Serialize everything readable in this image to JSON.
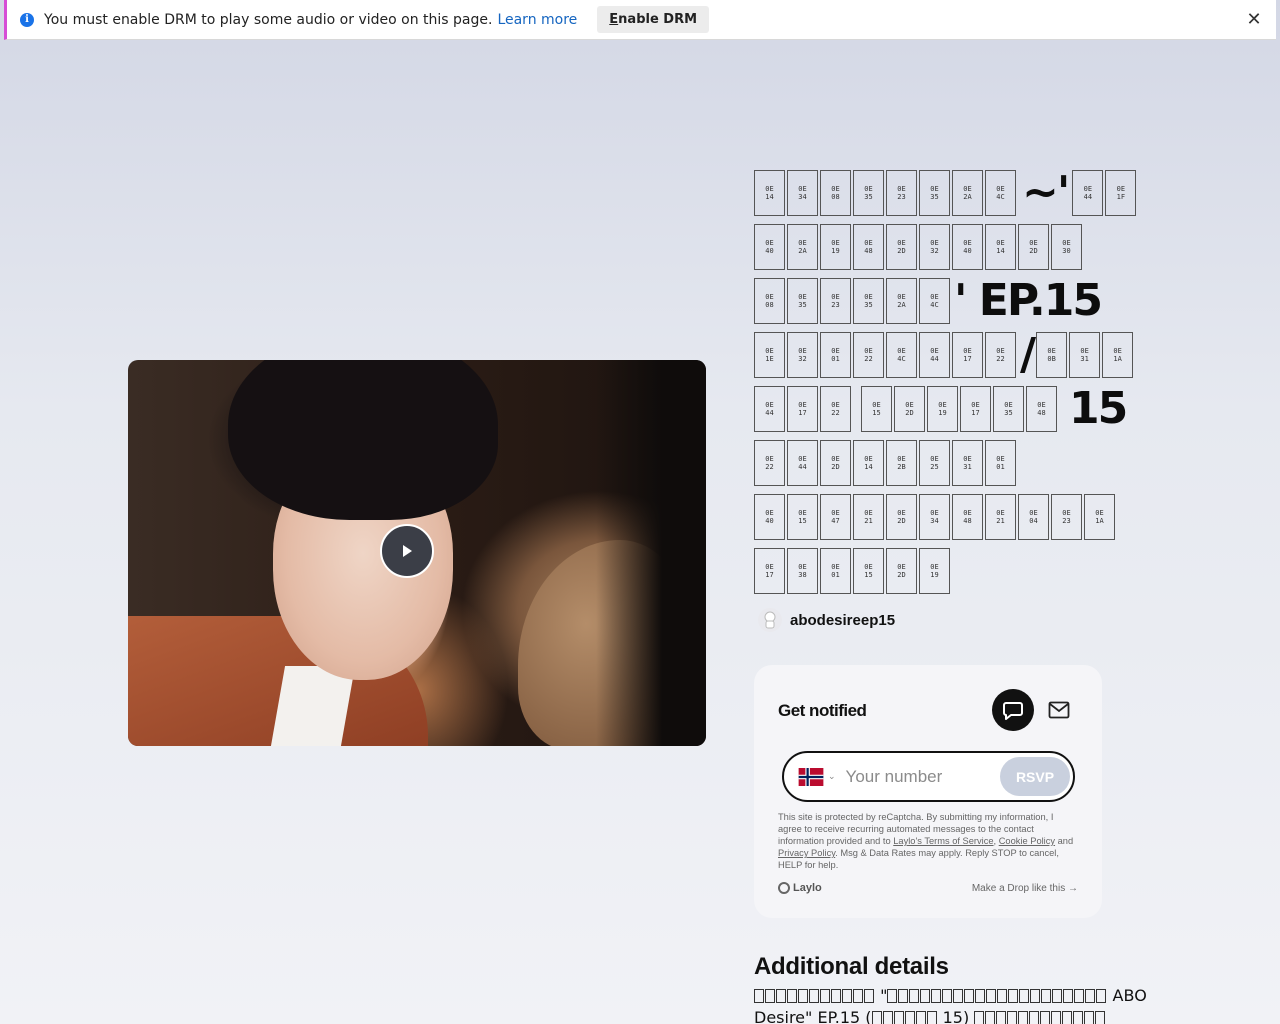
{
  "drm_bar": {
    "message": "You must enable DRM to play some audio or video on this page.",
    "learn_more": "Learn more",
    "enable_label_first": "E",
    "enable_label_rest": "nable DRM",
    "close": "✕"
  },
  "title": {
    "line1": [
      [
        "0E",
        "14"
      ],
      [
        "0E",
        "34"
      ],
      [
        "0E",
        "08"
      ],
      [
        "0E",
        "35"
      ],
      [
        "0E",
        "23"
      ],
      [
        "0E",
        "35"
      ],
      [
        "0E",
        "2A"
      ],
      [
        "0E",
        "4C"
      ]
    ],
    "line1_text": "~'",
    "line1_tail": [
      [
        "0E",
        "44"
      ],
      [
        "0E",
        "1F"
      ]
    ],
    "line2": [
      [
        "0E",
        "40"
      ],
      [
        "0E",
        "2A"
      ],
      [
        "0E",
        "19"
      ],
      [
        "0E",
        "48"
      ],
      [
        "0E",
        "2D"
      ],
      [
        "0E",
        "32"
      ],
      [
        "0E",
        "40"
      ],
      [
        "0E",
        "14"
      ],
      [
        "0E",
        "2D"
      ],
      [
        "0E",
        "30"
      ]
    ],
    "line3": [
      [
        "0E",
        "08"
      ],
      [
        "0E",
        "35"
      ],
      [
        "0E",
        "23"
      ],
      [
        "0E",
        "35"
      ],
      [
        "0E",
        "2A"
      ],
      [
        "0E",
        "4C"
      ]
    ],
    "line3_text": "' EP.15",
    "line4": [
      [
        "0E",
        "1E"
      ],
      [
        "0E",
        "32"
      ],
      [
        "0E",
        "01"
      ],
      [
        "0E",
        "22"
      ],
      [
        "0E",
        "4C"
      ],
      [
        "0E",
        "44"
      ],
      [
        "0E",
        "17"
      ],
      [
        "0E",
        "22"
      ]
    ],
    "line4_text": "/",
    "line4_tail": [
      [
        "0E",
        "0B"
      ],
      [
        "0E",
        "31"
      ],
      [
        "0E",
        "1A"
      ]
    ],
    "line5": [
      [
        "0E",
        "44"
      ],
      [
        "0E",
        "17"
      ],
      [
        "0E",
        "22"
      ]
    ],
    "line5b": [
      [
        "0E",
        "15"
      ],
      [
        "0E",
        "2D"
      ],
      [
        "0E",
        "19"
      ],
      [
        "0E",
        "17"
      ],
      [
        "0E",
        "35"
      ],
      [
        "0E",
        "48"
      ]
    ],
    "line5_text": "15",
    "line6": [
      [
        "0E",
        "22"
      ],
      [
        "0E",
        "44"
      ],
      [
        "0E",
        "2D"
      ],
      [
        "0E",
        "14"
      ],
      [
        "0E",
        "2B"
      ],
      [
        "0E",
        "25"
      ],
      [
        "0E",
        "31"
      ],
      [
        "0E",
        "01"
      ]
    ],
    "line7": [
      [
        "0E",
        "40"
      ],
      [
        "0E",
        "15"
      ],
      [
        "0E",
        "47"
      ],
      [
        "0E",
        "21"
      ],
      [
        "0E",
        "2D"
      ],
      [
        "0E",
        "34"
      ],
      [
        "0E",
        "48"
      ],
      [
        "0E",
        "21"
      ],
      [
        "0E",
        "04"
      ],
      [
        "0E",
        "23"
      ],
      [
        "0E",
        "1A"
      ]
    ],
    "line8": [
      [
        "0E",
        "17"
      ],
      [
        "0E",
        "38"
      ],
      [
        "0E",
        "01"
      ],
      [
        "0E",
        "15"
      ],
      [
        "0E",
        "2D"
      ],
      [
        "0E",
        "19"
      ]
    ]
  },
  "author": {
    "name": "abodesireep15"
  },
  "notify": {
    "title": "Get notified",
    "phone_placeholder": "Your number",
    "rsvp": "RSVP",
    "legal_1": "This site is protected by reCaptcha. By submitting my information, I agree to receive recurring automated messages to the contact information provided and to ",
    "terms": "Laylo's Terms of Service",
    "comma": ", ",
    "cookie": "Cookie Policy",
    "and": " and ",
    "privacy": "Privacy Policy",
    "legal_2": ". Msg & Data Rates may apply. Reply STOP to cancel, HELP for help.",
    "brand": "Laylo",
    "drop_link": "Make a Drop like this  →"
  },
  "details": {
    "heading": "Additional details",
    "line1_text": " \"",
    "line1_end": "ABO",
    "line2_text": "Desire\" EP.15 (",
    "line2_mid": "15)"
  },
  "colors": {
    "accent": "#1565c0",
    "rsvp_disabled": "#c9d0de",
    "drm_bar_border": "#d64dd6"
  }
}
